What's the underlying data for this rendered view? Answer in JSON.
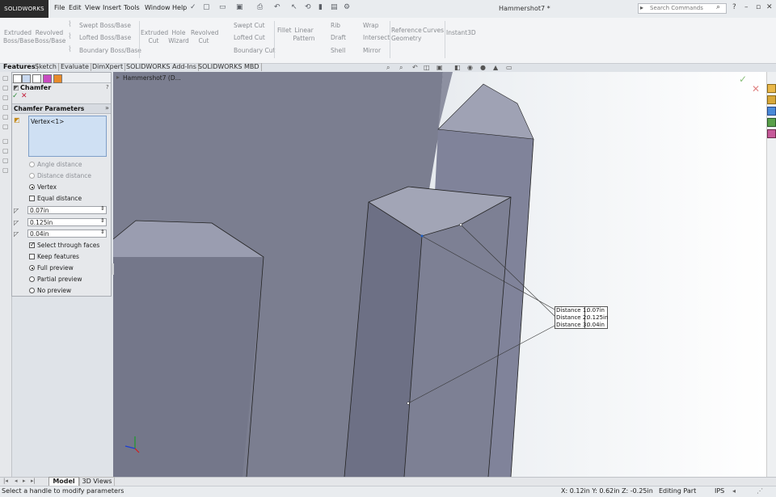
{
  "app": {
    "logo": "SOLIDWORKS",
    "document_title": "Hammershot7 *"
  },
  "menu": [
    "File",
    "Edit",
    "View",
    "Insert",
    "Tools",
    "Window",
    "Help"
  ],
  "search": {
    "placeholder": "Search Commands"
  },
  "ribbon": {
    "extruded_boss": "Extruded Boss/Base",
    "revolved_boss": "Revolved Boss/Base",
    "swept_boss": "Swept Boss/Base",
    "lofted_boss": "Lofted Boss/Base",
    "boundary_boss": "Boundary Boss/Base",
    "extruded_cut": "Extruded Cut",
    "hole_wizard": "Hole Wizard",
    "revolved_cut": "Revolved Cut",
    "swept_cut": "Swept Cut",
    "lofted_cut": "Lofted Cut",
    "boundary_cut": "Boundary Cut",
    "fillet": "Fillet",
    "linear_pattern": "Linear Pattern",
    "rib": "Rib",
    "draft": "Draft",
    "shell": "Shell",
    "wrap": "Wrap",
    "intersect": "Intersect",
    "mirror": "Mirror",
    "reference_geometry": "Reference Geometry",
    "curves": "Curves",
    "instant3d": "Instant3D"
  },
  "tabs": [
    "Features",
    "Sketch",
    "Evaluate",
    "DimXpert",
    "SOLIDWORKS Add-Ins",
    "SOLIDWORKS MBD"
  ],
  "tree_root": "Hammershot7 (D...",
  "property_manager": {
    "title": "Chamfer",
    "section": "Chamfer Parameters",
    "selection": "Vertex<1>",
    "options": {
      "angle_distance": "Angle distance",
      "distance_distance": "Distance distance",
      "vertex": "Vertex",
      "equal_distance": "Equal distance",
      "select_through_faces": "Select through faces",
      "keep_features": "Keep features",
      "full_preview": "Full preview",
      "partial_preview": "Partial preview",
      "no_preview": "No preview"
    },
    "values": {
      "d1": "0.07in",
      "d2": "0.125in",
      "d3": "0.04in"
    }
  },
  "callout": {
    "distance1": "Distance 1:",
    "v1": "0.07in",
    "distance2": "Distance 2:",
    "v2": "0.125in",
    "distance3": "Distance 3:",
    "v3": "0.04in"
  },
  "bottom_tabs": {
    "model": "Model",
    "views": "3D Views"
  },
  "status": {
    "message": "Select a handle to modify parameters",
    "coords": "X: 0.12in Y: 0.62in Z: -0.25in",
    "mode": "Editing Part",
    "units": "IPS"
  },
  "colors": {
    "accent": "#c41e3a",
    "ok": "#2e8b3a",
    "part": "#7a7d8f"
  }
}
